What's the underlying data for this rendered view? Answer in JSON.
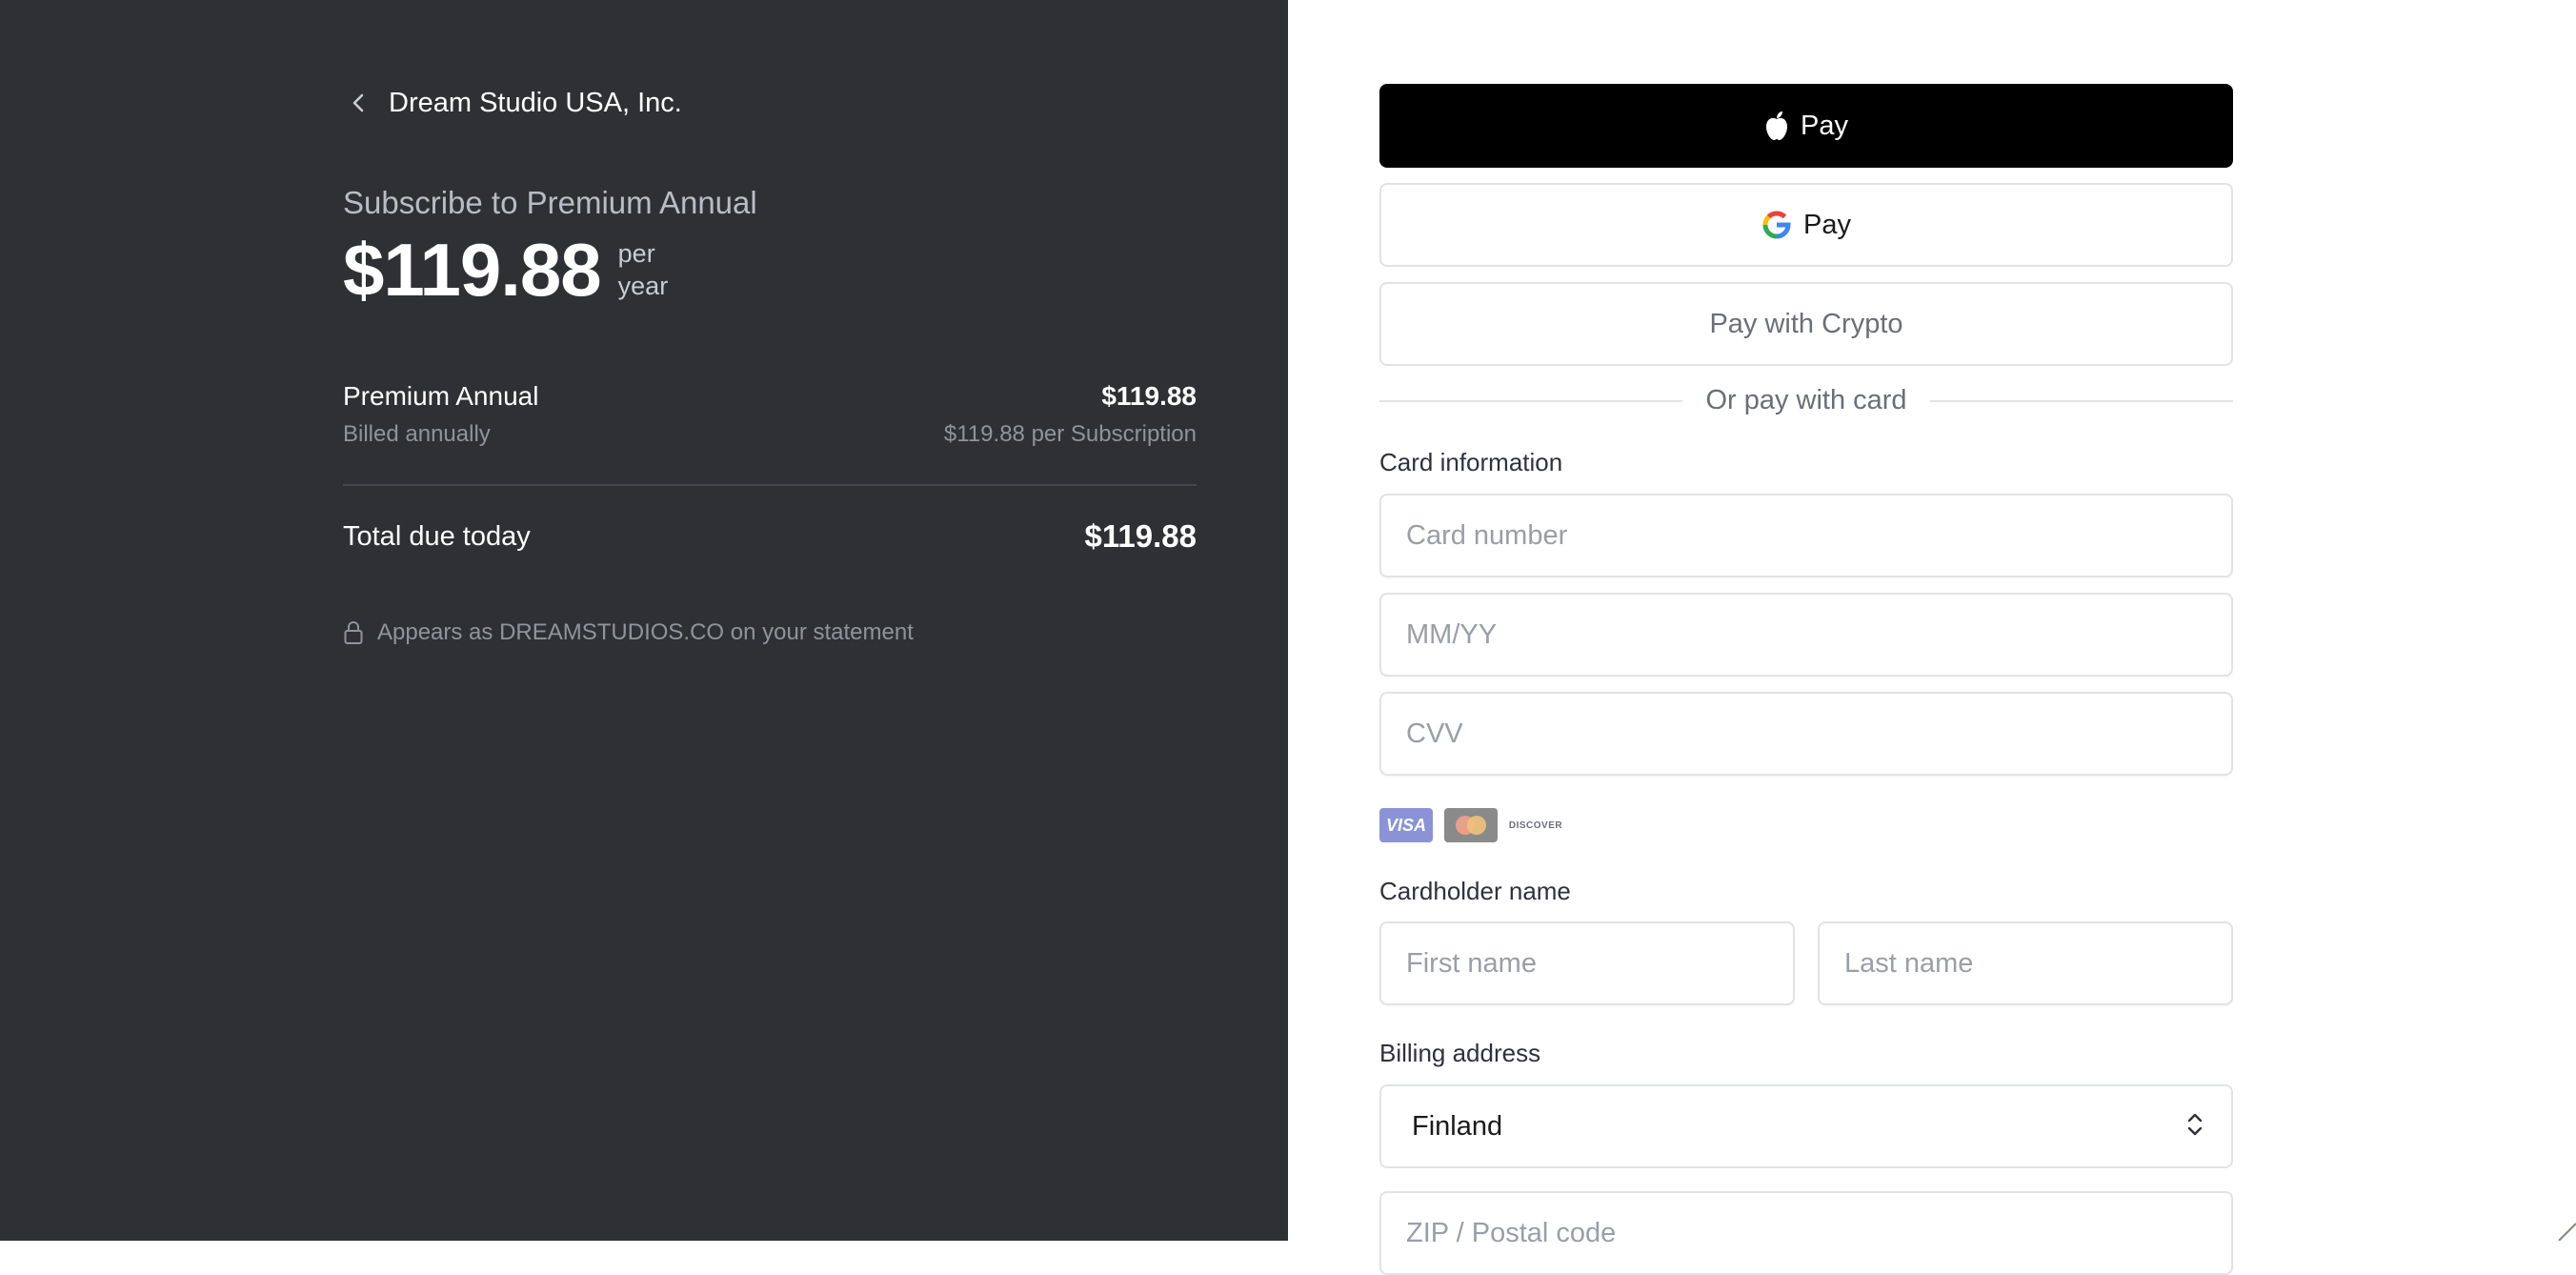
{
  "summary": {
    "merchant_name": "Dream Studio USA, Inc.",
    "subscribe_title": "Subscribe to Premium Annual",
    "price": "$119.88",
    "period_line1": "per",
    "period_line2": "year",
    "line_item": {
      "name": "Premium Annual",
      "amount": "$119.88",
      "billing": "Billed annually",
      "unit_price": "$119.88 per Subscription"
    },
    "total_label": "Total due today",
    "total_amount": "$119.88",
    "statement_text": "Appears as DREAMSTUDIOS.CO on your statement"
  },
  "payment": {
    "apple_pay_label": "Pay",
    "google_pay_label": "Pay",
    "crypto_label": "Pay with Crypto",
    "or_text": "Or pay with card",
    "card_info_label": "Card information",
    "card_number_placeholder": "Card number",
    "expiry_placeholder": "MM/YY",
    "cvv_placeholder": "CVV",
    "card_brands": [
      "VISA",
      "mastercard",
      "DISCOVER"
    ],
    "cardholder_label": "Cardholder name",
    "first_name_placeholder": "First name",
    "last_name_placeholder": "Last name",
    "billing_label": "Billing address",
    "country_value": "Finland",
    "zip_placeholder": "ZIP / Postal code"
  },
  "colors": {
    "left_panel_bg": "#2f3033",
    "apple_pay_bg": "#000000",
    "border": "#e1e3e6",
    "muted_text": "#8f949c"
  }
}
